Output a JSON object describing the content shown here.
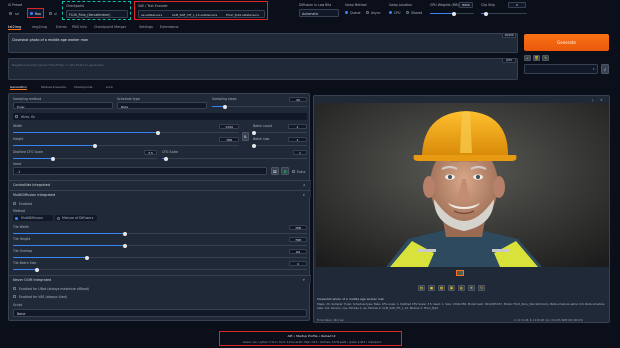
{
  "top": {
    "ui_preset_label": "UI Preset",
    "ui_preset_options": [
      "sd",
      "flux",
      "xl"
    ],
    "checkpoint_label": "Checkpoint",
    "checkpoint_value": "FLUX_Rina_(Xercaltimism)",
    "vae_label": "VAE / Text Encoder",
    "vae_chips": [
      "ae.safetensors",
      "CLIP_SAE_VIT_L_14.safetensors",
      "t5xxl_fp16.safetensors"
    ],
    "diffusion_label": "Diffusion in Low Bits",
    "diffusion_value": "Automatic",
    "swap_method_label": "Swap Method",
    "swap_method_options": [
      "Queue",
      "Async"
    ],
    "swap_location_label": "Swap Location",
    "swap_location_options": [
      "CPU",
      "Shared"
    ],
    "gpu_weights_label": "GPU Weights (MB)",
    "gpu_weights_value": "8950",
    "gpu_weights_fraction": 0.55,
    "clip_skip_label": "Clip Skip",
    "clip_skip_value": "2"
  },
  "tabs": [
    "txt2img",
    "img2img",
    "Extras",
    "PNG Info",
    "Checkpoint Merger",
    "Settings",
    "Extensions"
  ],
  "prompt": {
    "text": "Closeshot photo of a middle age worker man",
    "counter": "10/150",
    "neg_placeholder": "Negative prompt (press Ctrl+Enter or Alt+Enter to generate)",
    "neg_counter": "0/75"
  },
  "generate_label": "Generate",
  "subtabs": [
    "Generation",
    "Textual Inversion",
    "Checkpoints",
    "Lora"
  ],
  "params": {
    "sampling_method_label": "Sampling method",
    "sampling_method": "Euler",
    "schedule_label": "Schedule type",
    "schedule": "Beta",
    "steps_label": "Sampling steps",
    "steps": "20",
    "steps_fraction": 0.13,
    "hires_label": "Hires. fix",
    "width_label": "Width",
    "width": "1344",
    "width_fraction": 0.64,
    "height_label": "Height",
    "height": "768",
    "height_fraction": 0.36,
    "batch_count_label": "Batch count",
    "batch_count": "1",
    "batch_size_label": "Batch size",
    "batch_size": "1",
    "distilled_cfg_label": "Distilled CFG Scale",
    "distilled_cfg": "3.5",
    "cfg_label": "CFG Scale",
    "cfg": "1",
    "seed_label": "Seed",
    "seed": "-1",
    "extra_label": "Extra"
  },
  "accordions": {
    "controlnet": "ControlNet Integrated",
    "multidiffusion": "MultiDiffusion Integrated",
    "enabled_label": "Enabled",
    "method_label": "Method",
    "method_options": [
      "MultiDiffusion",
      "Mixture of Diffusers"
    ],
    "tile_width_label": "Tile Width",
    "tile_width": "768",
    "tile_height_label": "Tile Height",
    "tile_height": "768",
    "tile_overlap_label": "Tile Overlap",
    "tile_overlap": "64",
    "tile_batch_label": "Tile Batch Size",
    "tile_batch": "4",
    "neveroom": "Never OOM Integrated",
    "unet_label": "Enabled for UNet (always maximize offload)",
    "vae_label": "Enabled for VAE (always tiled)",
    "script_label": "Script",
    "script_value": "None"
  },
  "output": {
    "caption": "Closeshot photo of a middle age worker man",
    "info": "Steps: 20, Sampler: Euler, Schedule type: Beta, CFG scale: 1, Distilled CFG Scale: 3.5, Seed: 1, Size: 1344x768, Model hash: 9014345327, Model: FLUX_Rina_(Xercaltimism), Beta schedule alpha: 0.6, Beta schedule beta: 0.6, Version: neo, Module 1: ae, Module 2: CLIP_SAE_VIT_L_14, Module 3: t5xxl_fp16",
    "time_text": "Time taken: 49.6 sec.",
    "vram_text": "A: 14.31 GB, R: 14.90 GB, Sys: 16.0/15.9988 GB (100.0%)"
  },
  "footer": {
    "links": [
      "API",
      "Startup Profile",
      "Reload UI"
    ],
    "versions": "version: neo  •  python: 3.11.9  •  torch: 2.9.0+cu128  •  flash: 2.8.3  •  xformers: 0.0.32.post2  •  gradio: 4.40.0  •  checkpoint: "
  },
  "colors": {
    "accent": "#f97316",
    "slider": "#3b82f6",
    "highlight_red": "#dc2626",
    "highlight_teal": "#14b8a6"
  },
  "icons": [
    "refresh-icon",
    "folder-icon",
    "save-icon",
    "zip-icon",
    "image-icon",
    "palette-icon",
    "star-icon",
    "dice-icon",
    "recycle-icon",
    "close-icon",
    "download-icon"
  ]
}
